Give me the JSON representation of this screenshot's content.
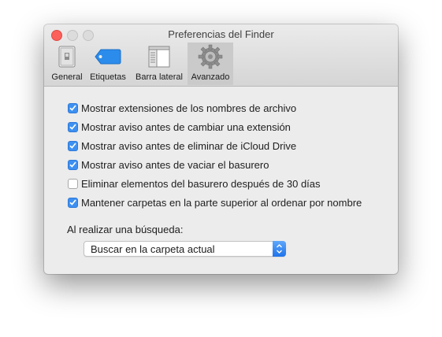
{
  "window": {
    "title": "Preferencias del Finder"
  },
  "toolbar": {
    "tabs": [
      {
        "label": "General",
        "icon": "general-icon"
      },
      {
        "label": "Etiquetas",
        "icon": "tag-icon"
      },
      {
        "label": "Barra lateral",
        "icon": "sidebar-icon"
      },
      {
        "label": "Avanzado",
        "icon": "gear-icon",
        "selected": true
      }
    ]
  },
  "options": [
    {
      "label": "Mostrar extensiones de los nombres de archivo",
      "checked": true
    },
    {
      "label": "Mostrar aviso antes de cambiar una extensión",
      "checked": true
    },
    {
      "label": "Mostrar aviso antes de eliminar de iCloud Drive",
      "checked": true
    },
    {
      "label": "Mostrar aviso antes de vaciar el basurero",
      "checked": true
    },
    {
      "label": "Eliminar elementos del basurero después de 30 días",
      "checked": false
    },
    {
      "label": "Mantener carpetas en la parte superior al ordenar por nombre",
      "checked": true
    }
  ],
  "search": {
    "label": "Al realizar una búsqueda:",
    "selected": "Buscar en la carpeta actual"
  },
  "colors": {
    "accent": "#3d90f2",
    "close": "#fc605b"
  }
}
